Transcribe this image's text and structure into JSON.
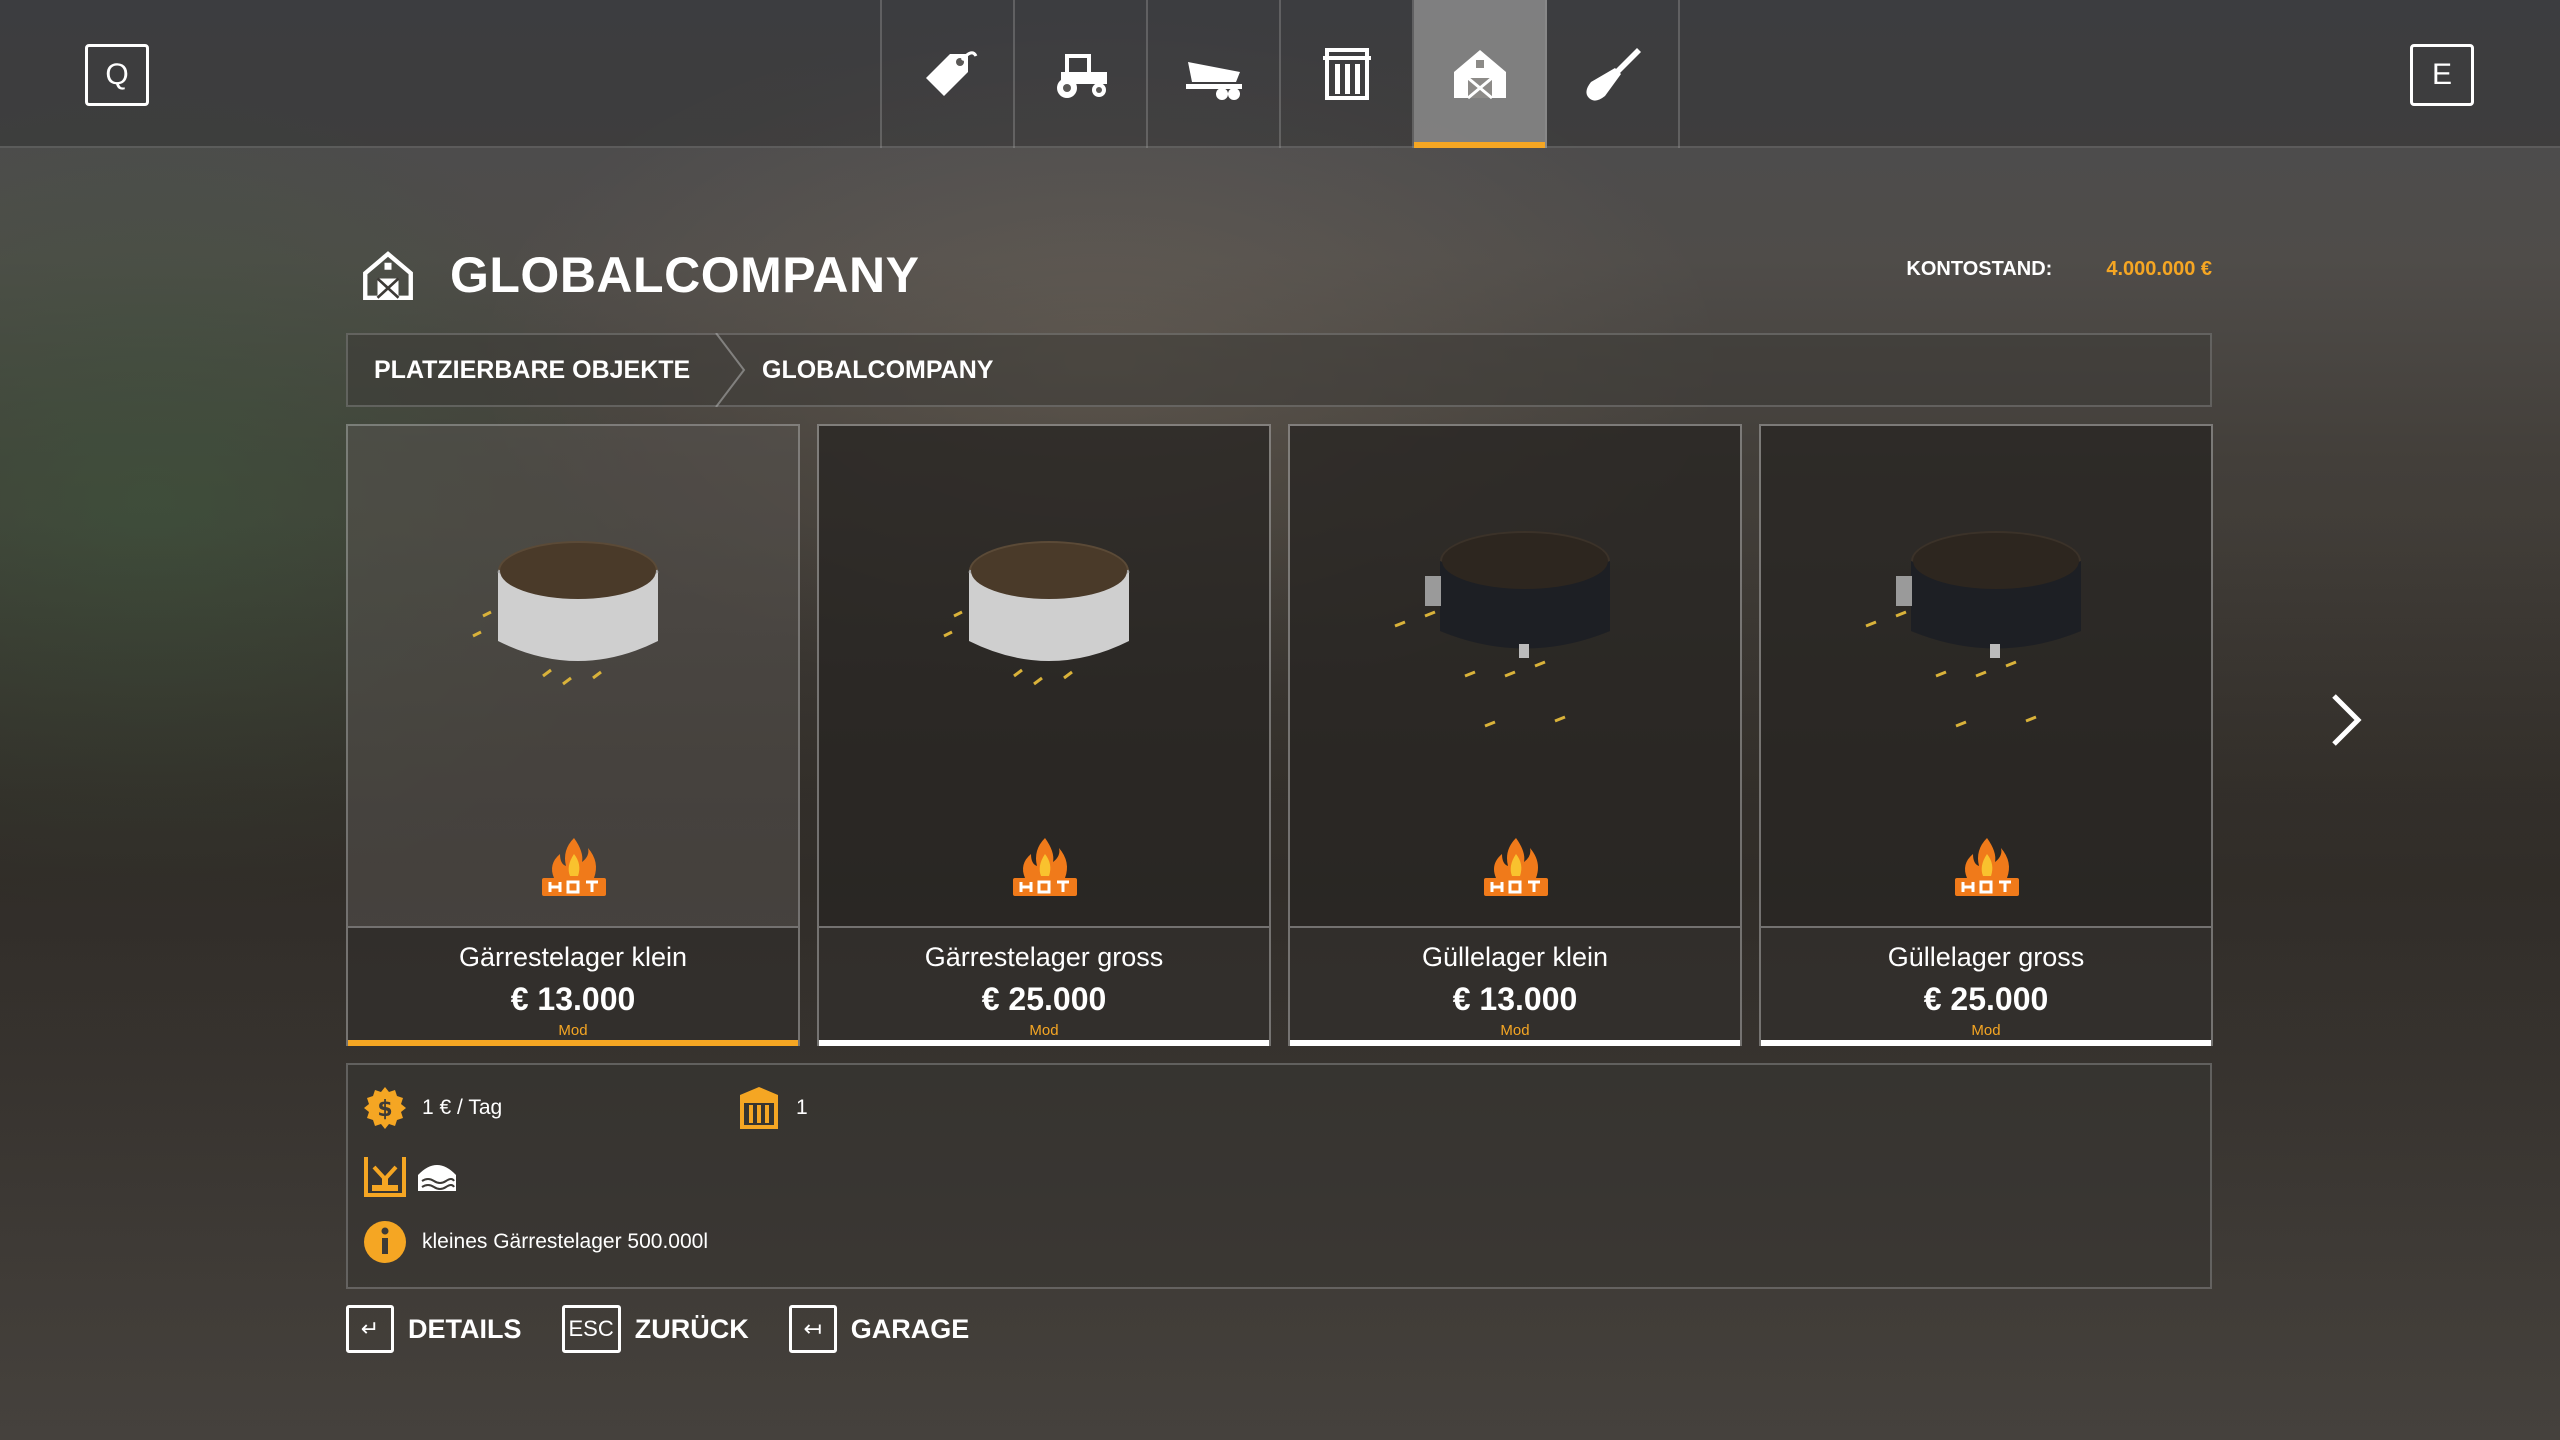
{
  "nav": {
    "left_key": "Q",
    "right_key": "E",
    "tabs": [
      {
        "icon": "price-tag-icon",
        "active": false
      },
      {
        "icon": "tractor-icon",
        "active": false
      },
      {
        "icon": "trailer-icon",
        "active": false
      },
      {
        "icon": "pallet-icon",
        "active": false
      },
      {
        "icon": "barn-icon",
        "active": true
      },
      {
        "icon": "shovel-icon",
        "active": false
      }
    ]
  },
  "header": {
    "title": "GLOBALCOMPANY",
    "icon": "barn-icon",
    "balance_label": "KONTOSTAND:",
    "balance_value": "4.000.000 €"
  },
  "breadcrumb": {
    "items": [
      "PLATZIERBARE OBJEKTE",
      "GLOBALCOMPANY"
    ]
  },
  "items": [
    {
      "name": "Gärrestelager klein",
      "price": "€ 13.000",
      "tag": "Mod",
      "tank": "white",
      "selected": true
    },
    {
      "name": "Gärrestelager gross",
      "price": "€ 25.000",
      "tag": "Mod",
      "tank": "white",
      "selected": false
    },
    {
      "name": "Güllelager klein",
      "price": "€ 13.000",
      "tag": "Mod",
      "tank": "black",
      "selected": false
    },
    {
      "name": "Güllelager gross",
      "price": "€ 25.000",
      "tag": "Mod",
      "tank": "black",
      "selected": false
    }
  ],
  "details": {
    "cost": "1 € / Tag",
    "count": "1",
    "info": "kleines Gärrestelager 500.000l"
  },
  "footer": {
    "details_key": "↵",
    "details_label": "DETAILS",
    "back_key": "ESC",
    "back_label": "ZURÜCK",
    "garage_key": "↤",
    "garage_label": "GARAGE"
  },
  "colors": {
    "accent": "#f5a623",
    "text": "#ffffff"
  }
}
